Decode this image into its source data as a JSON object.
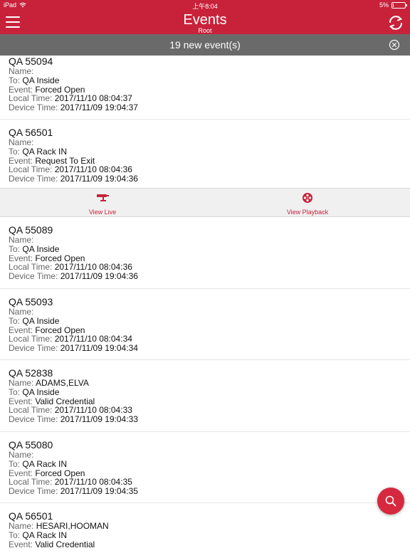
{
  "status_bar": {
    "carrier": "iPad",
    "time": "上午8:04",
    "battery": "5%",
    "battery_level": 0.05
  },
  "header": {
    "title": "Events",
    "subtitle": "Root",
    "menu_icon": "hamburger-menu-icon",
    "refresh_icon": "refresh-icon"
  },
  "banner": {
    "text": "19 new event(s)",
    "close_icon": "close-circle-icon"
  },
  "labels": {
    "name": "Name:",
    "to": "To:",
    "event": "Event:",
    "local_time": "Local Time:",
    "device_time": "Device Time:"
  },
  "events_top": [
    {
      "title": "QA 55094",
      "name": "",
      "to": "QA Inside",
      "event": "Forced Open",
      "local_time": "2017/11/10 08:04:37",
      "device_time": "2017/11/09 19:04:37"
    },
    {
      "title": "QA 56501",
      "name": "",
      "to": "QA Rack IN",
      "event": "Request To Exit",
      "local_time": "2017/11/10 08:04:36",
      "device_time": "2017/11/09 19:04:36"
    }
  ],
  "actions": {
    "view_live": "View Live",
    "view_playback": "View Playback",
    "view_live_icon": "cctv-camera-icon",
    "view_playback_icon": "film-reel-icon"
  },
  "events_bottom": [
    {
      "title": "QA 55089",
      "name": "",
      "to": "QA Inside",
      "event": "Forced Open",
      "local_time": "2017/11/10 08:04:36",
      "device_time": "2017/11/09 19:04:36"
    },
    {
      "title": "QA 55093",
      "name": "",
      "to": "QA Inside",
      "event": "Forced Open",
      "local_time": "2017/11/10 08:04:34",
      "device_time": "2017/11/09 19:04:34"
    },
    {
      "title": "QA 52838",
      "name": "ADAMS,ELVA",
      "to": "QA Inside",
      "event": "Valid Credential",
      "local_time": "2017/11/10 08:04:33",
      "device_time": "2017/11/09 19:04:33"
    },
    {
      "title": "QA 55080",
      "name": "",
      "to": "QA Rack IN",
      "event": "Forced Open",
      "local_time": "2017/11/10 08:04:35",
      "device_time": "2017/11/09 19:04:35"
    },
    {
      "title": "QA 56501",
      "name": "HESARI,HOOMAN",
      "to": "QA Rack IN",
      "event": "Valid Credential",
      "local_time": "",
      "device_time": ""
    }
  ],
  "fab": {
    "icon": "search-icon"
  },
  "colors": {
    "brand": "#c8223a",
    "banner": "#6a6a6a",
    "action_bar": "#f0f0f0"
  }
}
